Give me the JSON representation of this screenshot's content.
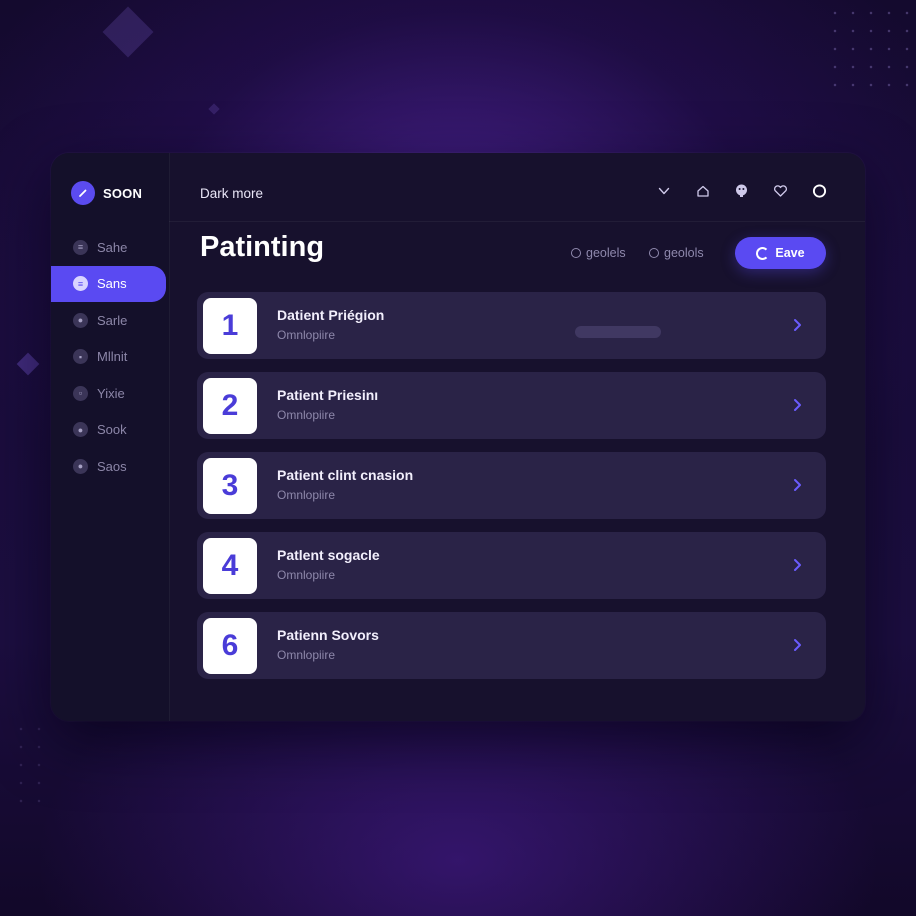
{
  "brand": {
    "name": "SOON",
    "logo_icon": "pencil-icon"
  },
  "topbar": {
    "title": "Dark more",
    "icons": [
      "chevron-down-icon",
      "home-icon",
      "face-icon",
      "heart-icon",
      "circle-icon"
    ]
  },
  "sidebar": {
    "items": [
      {
        "label": "Sahe",
        "active": false
      },
      {
        "label": "Sans",
        "active": true
      },
      {
        "label": "Sarle",
        "active": false
      },
      {
        "label": "Mllnit",
        "active": false
      },
      {
        "label": "Yixie",
        "active": false
      },
      {
        "label": "Sook",
        "active": false
      },
      {
        "label": "Saos",
        "active": false
      }
    ]
  },
  "main": {
    "title": "Patinting",
    "filters": [
      {
        "label": "geolels"
      },
      {
        "label": "geolols"
      }
    ],
    "save_label": "Eave",
    "rows": [
      {
        "number": "1",
        "title": "Datient Priégion",
        "subtitle": "Omnlopiire"
      },
      {
        "number": "2",
        "title": "Patient Priesinı",
        "subtitle": "Omnlopiire"
      },
      {
        "number": "3",
        "title": "Patient clint cnasion",
        "subtitle": "Omnlopiire"
      },
      {
        "number": "4",
        "title": "Patlent sogacle",
        "subtitle": "Omnlopiire"
      },
      {
        "number": "6",
        "title": "Patienn Sovors",
        "subtitle": "Omnlopiire"
      }
    ]
  },
  "colors": {
    "accent": "#5a4af2",
    "panel": "#17112d",
    "row": "#2a2347",
    "chevron": "#6b5cff"
  }
}
